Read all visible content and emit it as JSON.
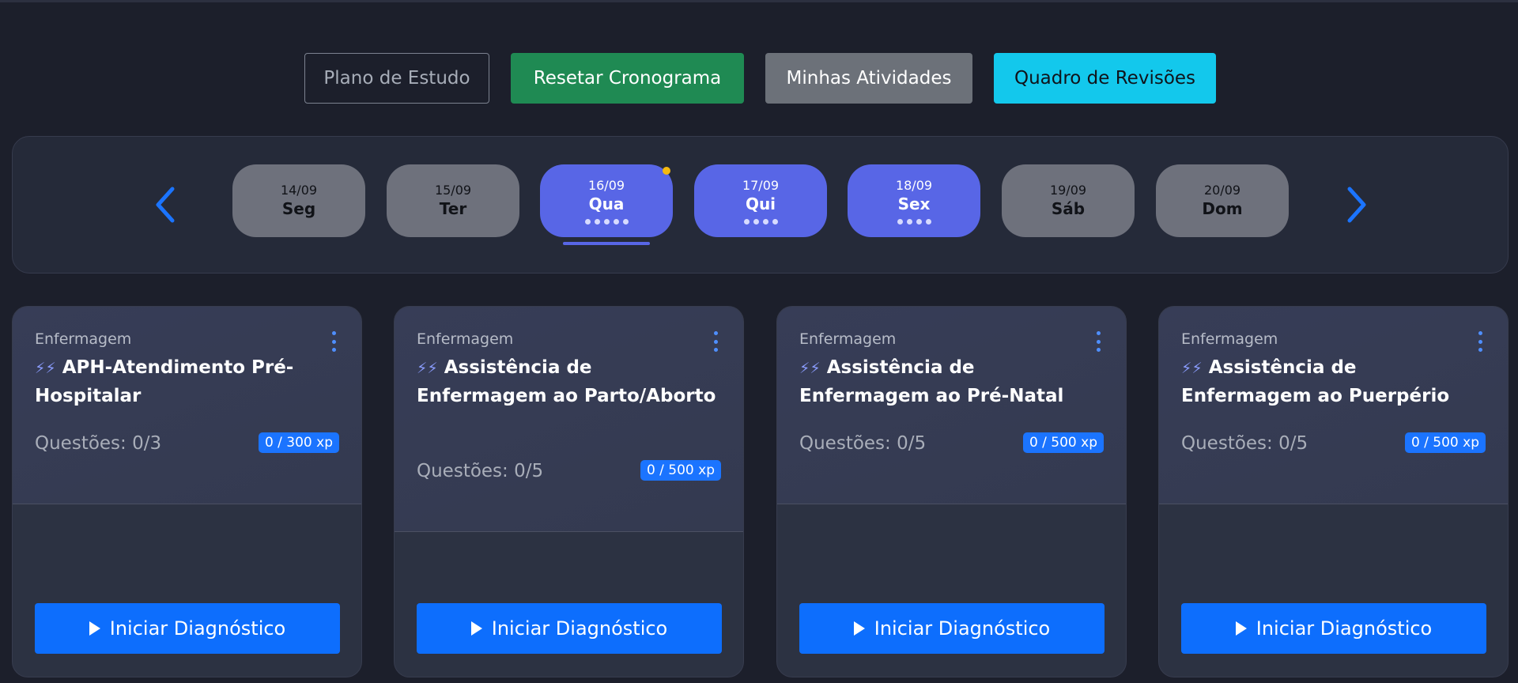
{
  "actions": {
    "plano": "Plano de Estudo",
    "resetar": "Resetar Cronograma",
    "minhas": "Minhas Atividades",
    "quadro": "Quadro de Revisões"
  },
  "week": {
    "days": [
      {
        "date": "14/09",
        "name": "Seg",
        "active": false
      },
      {
        "date": "15/09",
        "name": "Ter",
        "active": false
      },
      {
        "date": "16/09",
        "name": "Qua",
        "active": true,
        "tasks": 5,
        "today": true
      },
      {
        "date": "17/09",
        "name": "Qui",
        "active": true,
        "tasks": 4
      },
      {
        "date": "18/09",
        "name": "Sex",
        "active": true,
        "tasks": 4
      },
      {
        "date": "19/09",
        "name": "Sáb",
        "active": false
      },
      {
        "date": "20/09",
        "name": "Dom",
        "active": false
      }
    ]
  },
  "cards": [
    {
      "category": "Enfermagem",
      "title": "APH-Atendimento Pré-Hospitalar",
      "questions": "Questões: 0/3",
      "xp": "0 / 300 xp",
      "button": "Iniciar Diagnóstico"
    },
    {
      "category": "Enfermagem",
      "title": "Assistência de Enfermagem ao Parto/Aborto",
      "questions": "Questões: 0/5",
      "xp": "0 / 500 xp",
      "button": "Iniciar Diagnóstico"
    },
    {
      "category": "Enfermagem",
      "title": "Assistência de Enfermagem ao Pré-Natal",
      "questions": "Questões: 0/5",
      "xp": "0 / 500 xp",
      "button": "Iniciar Diagnóstico"
    },
    {
      "category": "Enfermagem",
      "title": "Assistência de Enfermagem ao Puerpério",
      "questions": "Questões: 0/5",
      "xp": "0 / 500 xp",
      "button": "Iniciar Diagnóstico"
    }
  ],
  "colors": {
    "background": "#1c1f2b",
    "active_day": "#5866e6",
    "primary": "#0d6efd",
    "success": "#1f8a53",
    "info": "#13c8ec",
    "today_marker": "#f5b90f"
  },
  "icons": {
    "nav_prev": "chevron-left-icon",
    "nav_next": "chevron-right-icon",
    "card_menu": "kebab-menu-icon",
    "title_prefix": "lightning-bolt-icon",
    "start": "play-icon"
  }
}
